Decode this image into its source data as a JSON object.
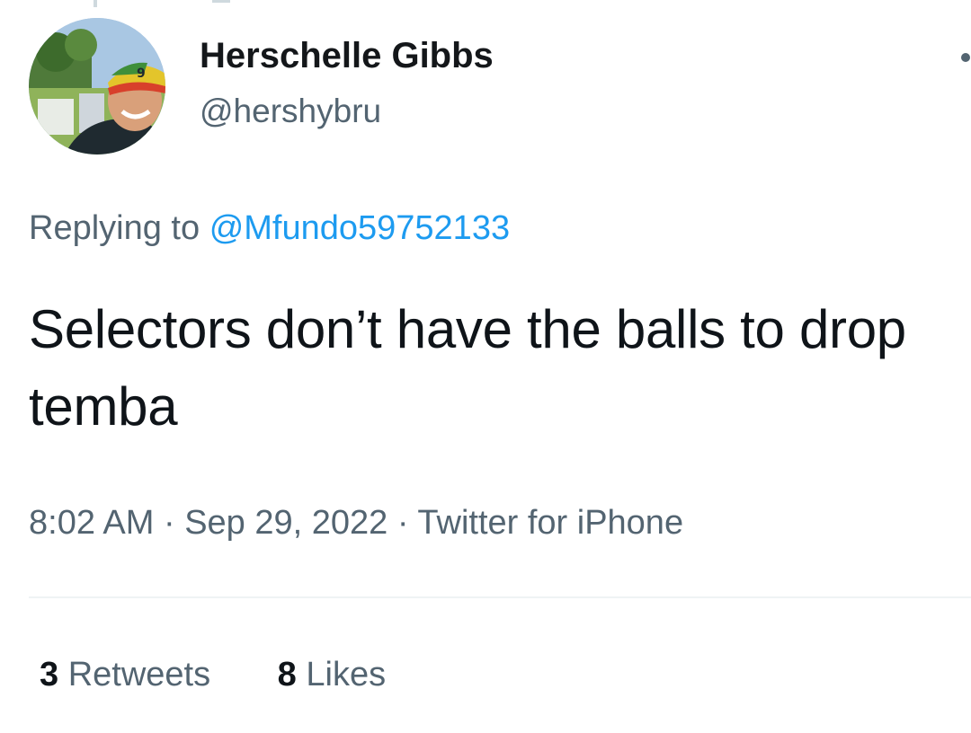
{
  "tweet": {
    "author_name": "Herschelle Gibbs",
    "author_handle": "@hershybru",
    "replying_prefix": "Replying to",
    "replying_to": "@Mfundo59752133",
    "text": "Selectors don’t have the balls to drop temba",
    "time": "8:02 AM",
    "separator": "·",
    "date": "Sep 29, 2022",
    "source": "Twitter for iPhone"
  },
  "stats": {
    "retweets_count": "3",
    "retweets_label": "Retweets",
    "likes_count": "8",
    "likes_label": "Likes"
  },
  "icons": {
    "more": "more-options-icon"
  },
  "colors": {
    "mention": "#1d9bf0",
    "secondary_text": "#536471",
    "primary_text": "#0f1419"
  }
}
